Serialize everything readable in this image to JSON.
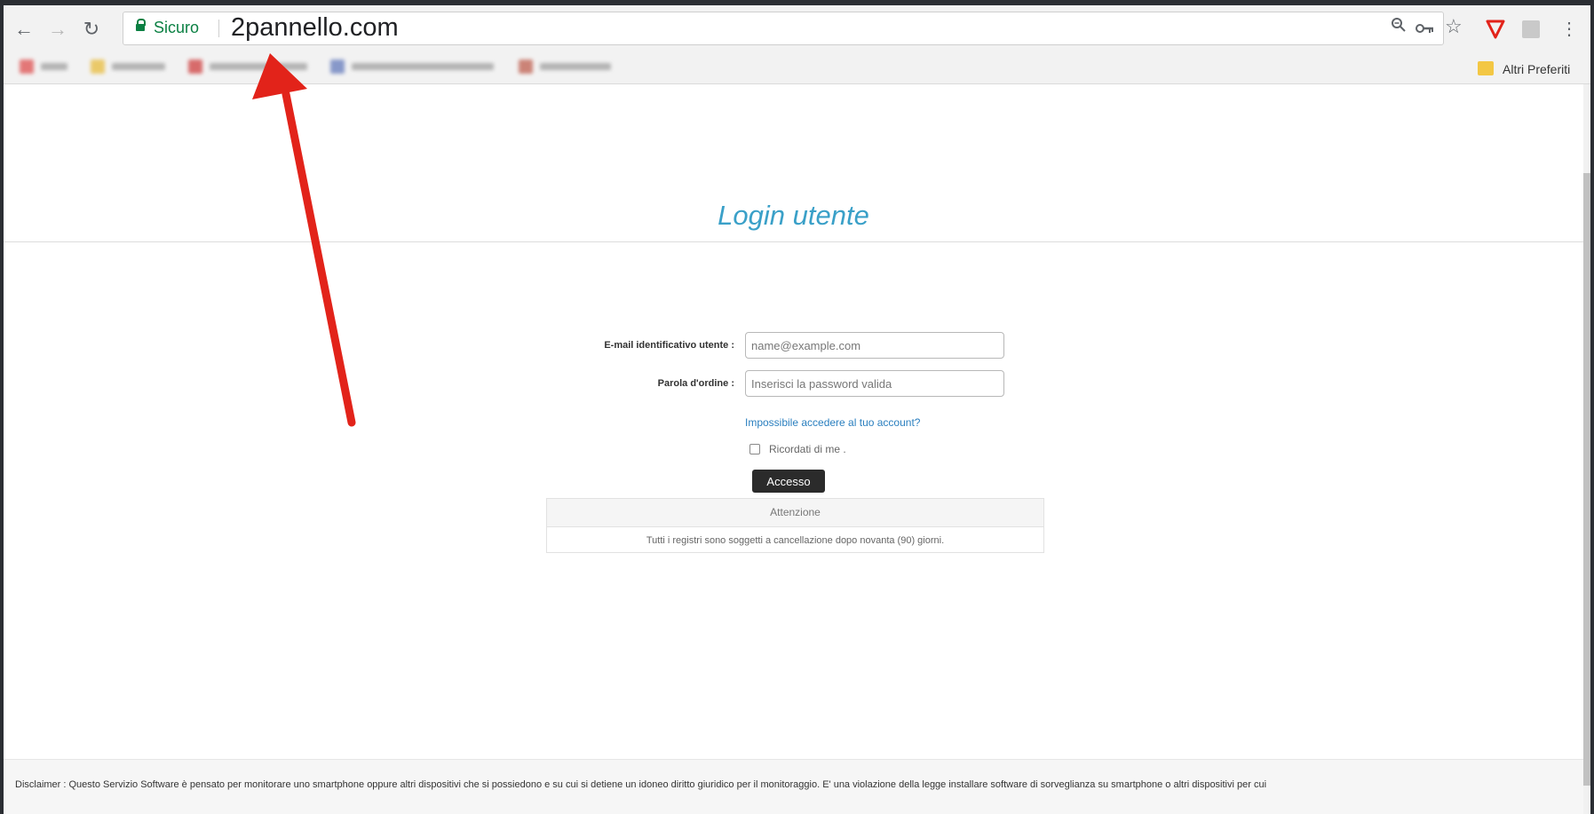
{
  "browser": {
    "secure_label": "Sicuro",
    "url": "2pannello.com",
    "other_bookmarks": "Altri Preferiti",
    "accent_red": "#e2231a",
    "secure_green": "#0b8043"
  },
  "login": {
    "title": "Login utente",
    "email_label": "E-mail identificativo utente :",
    "email_placeholder": "name@example.com",
    "password_label": "Parola d'ordine :",
    "password_placeholder": "Inserisci la password valida",
    "forgot_link": "Impossibile accedere al tuo account?",
    "remember_label": "Ricordati di me .",
    "remember_checked": false,
    "submit_label": "Accesso",
    "title_color": "#3aa0c8"
  },
  "notice": {
    "heading": "Attenzione",
    "body": "Tutti i registri sono soggetti a cancellazione dopo novanta (90) giorni."
  },
  "footer": {
    "disclaimer": "Disclaimer : Questo Servizio Software è pensato per monitorare uno smartphone oppure altri dispositivi che si possiedono e su cui si detiene un idoneo diritto giuridico per il monitoraggio. E' una violazione della legge installare software di sorveglianza su smartphone o altri dispositivi per cui"
  }
}
